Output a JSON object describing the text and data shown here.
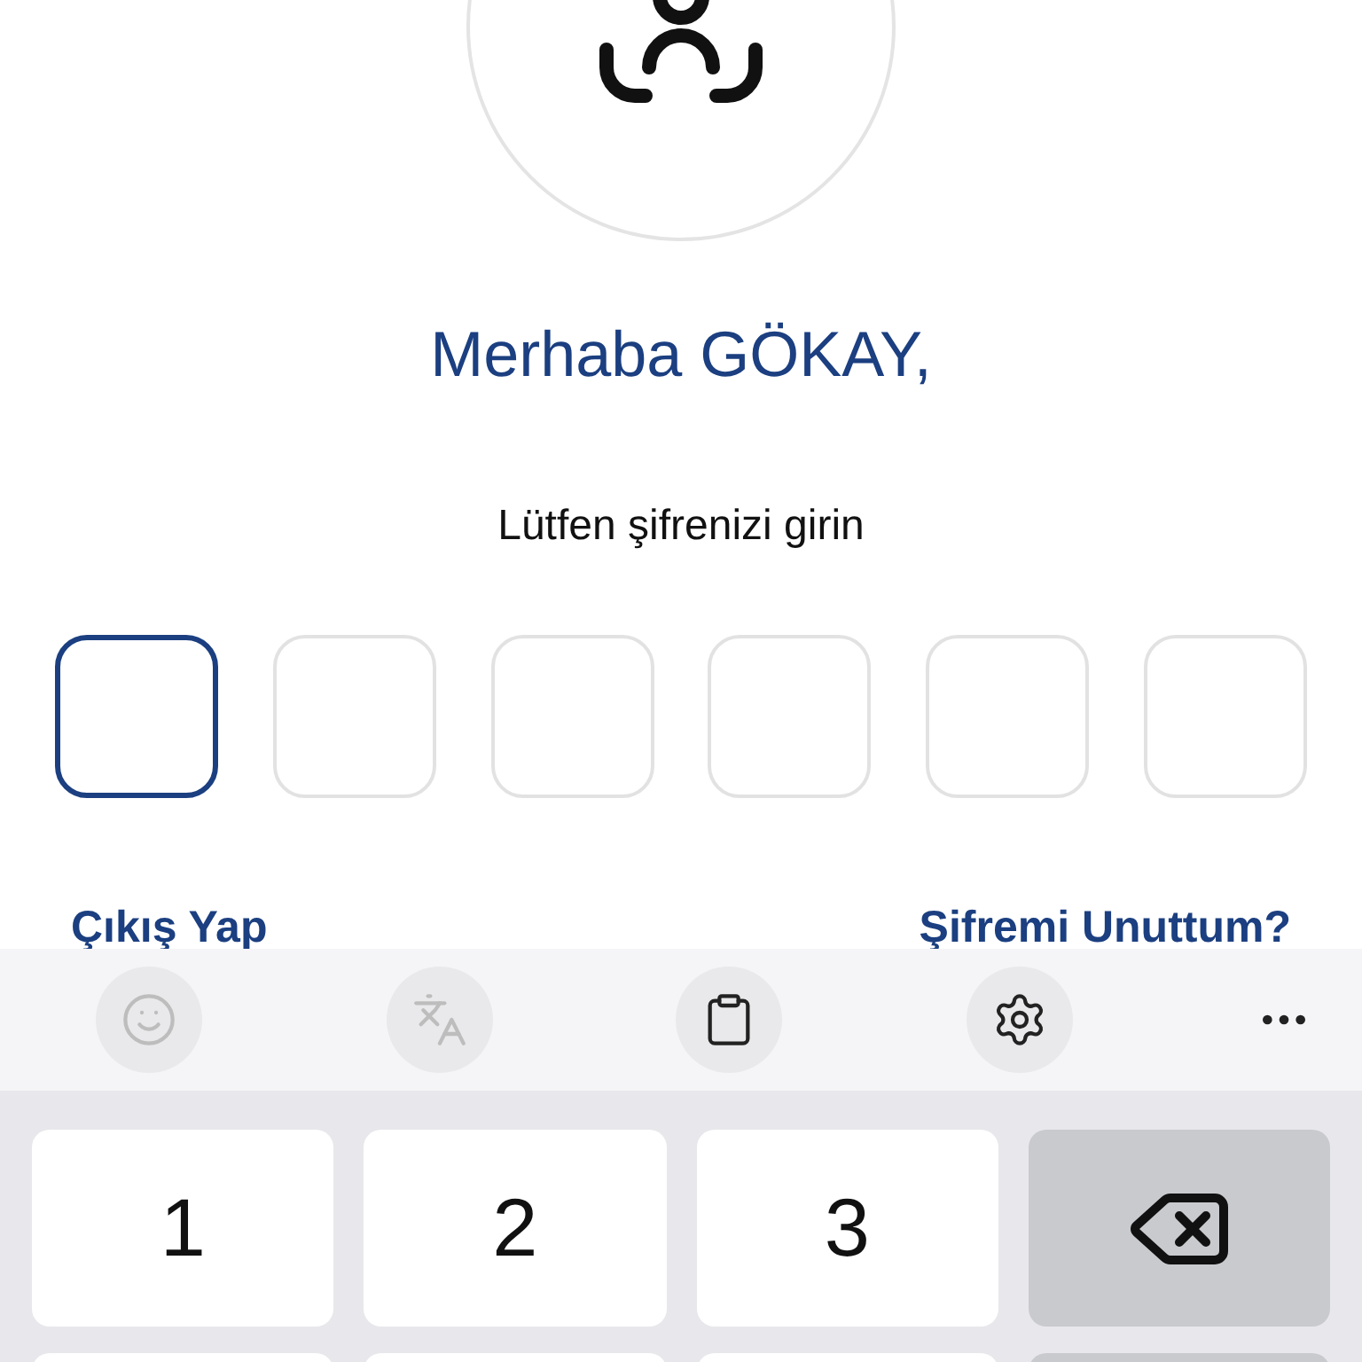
{
  "greeting": "Merhaba GÖKAY,",
  "prompt": "Lütfen şifrenizi girin",
  "pin_boxes": [
    {
      "selected": true
    },
    {
      "selected": false
    },
    {
      "selected": false
    },
    {
      "selected": false
    },
    {
      "selected": false
    },
    {
      "selected": false
    }
  ],
  "links": [
    "Çıkış Yap",
    "Şifremi Unuttum?"
  ],
  "keyboard": {
    "toolbar": [
      {
        "kind": "emoji",
        "disabled": true
      },
      {
        "kind": "translate",
        "disabled": true
      },
      {
        "kind": "clipboard",
        "disabled": false
      },
      {
        "kind": "settings",
        "disabled": false
      },
      {
        "kind": "more",
        "disabled": false
      }
    ],
    "keys": [
      {
        "kind": "digit",
        "label": "1"
      },
      {
        "kind": "digit",
        "label": "2"
      },
      {
        "kind": "digit",
        "label": "3"
      },
      {
        "kind": "backspace"
      }
    ]
  }
}
